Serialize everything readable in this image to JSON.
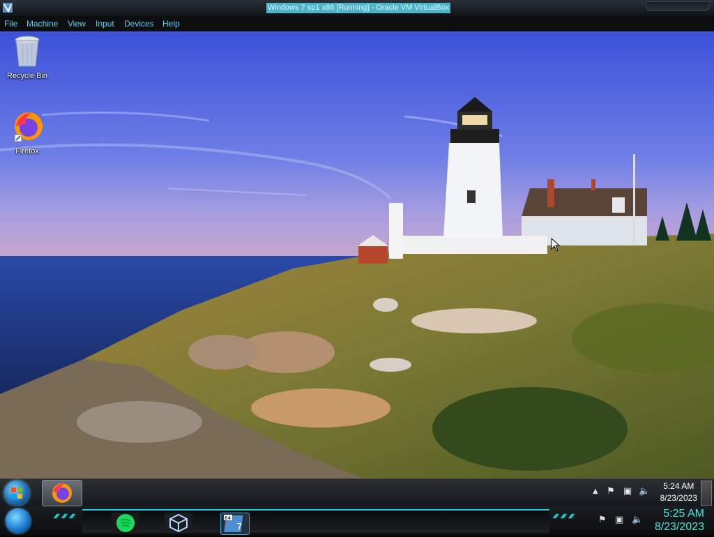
{
  "host_window": {
    "title": "Windows 7 sp1 x86 [Running] - Oracle VM VirtualBox",
    "menu": [
      "File",
      "Machine",
      "View",
      "Input",
      "Devices",
      "Help"
    ]
  },
  "desktop": {
    "icons": [
      {
        "label": "Recycle Bin",
        "icon": "recycle-bin-icon"
      },
      {
        "label": "Firefox",
        "icon": "firefox-icon"
      }
    ]
  },
  "guest_taskbar": {
    "pinned": [
      {
        "icon": "firefox-icon"
      }
    ],
    "clock": {
      "time": "5:24 AM",
      "date": "8/23/2023"
    },
    "tray_icons": [
      "show-hidden-icons-arrow",
      "action-center-flag-icon",
      "network-icon",
      "volume-icon"
    ]
  },
  "host_taskbar": {
    "pinned": [
      {
        "icon": "spotify-icon"
      },
      {
        "icon": "virtualbox-icon"
      },
      {
        "icon": "windows7-vm-icon",
        "badge": "64"
      }
    ],
    "clock": {
      "time": "5:25 AM",
      "date": "8/23/2023"
    },
    "tray_icons": [
      "action-center-flag-icon",
      "network-icon",
      "volume-icon"
    ]
  },
  "colors": {
    "title_highlight": "#4bb4c8",
    "menu_text": "#5ad0f0",
    "host_clock": "#48e4d8",
    "sky": "#4a5fd8",
    "sea": "#1c3c88"
  }
}
